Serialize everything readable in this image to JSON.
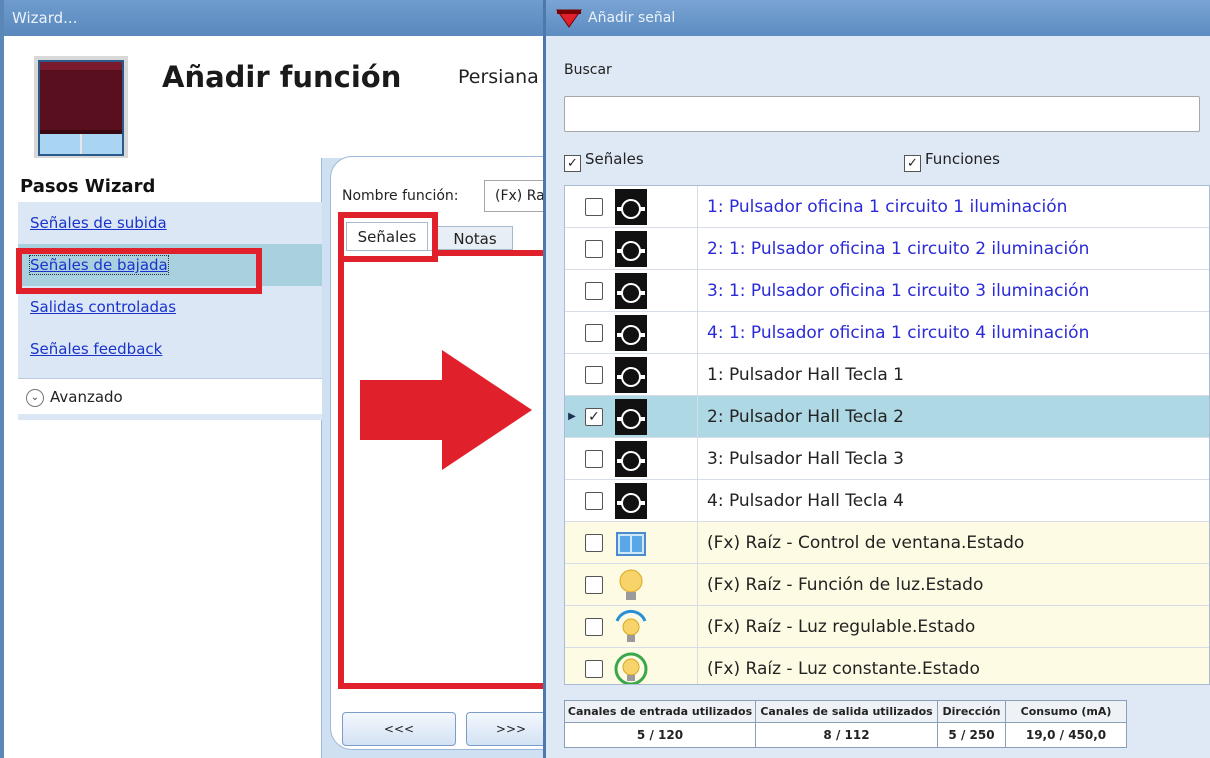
{
  "wizard": {
    "window_title": "Wizard...",
    "title": "Añadir función",
    "subtitle": "Persiana",
    "steps_title": "Pasos Wizard",
    "steps": [
      {
        "label": "Señales de subida"
      },
      {
        "label": "Señales de bajada"
      },
      {
        "label": "Salidas controladas"
      },
      {
        "label": "Señales feedback"
      }
    ],
    "active_step": "Señales de bajada",
    "advanced_label": "Avanzado",
    "function_name_label": "Nombre función:",
    "function_name_value": "(Fx) Raíz",
    "tabs": [
      {
        "label": "Señales"
      },
      {
        "label": "Notas"
      }
    ],
    "prev_button": "<<<",
    "next_button": ">>>"
  },
  "signal_window": {
    "title": "Añadir señal",
    "search_label": "Buscar",
    "search_value": "",
    "filters": [
      {
        "label": "Señales",
        "checked": true
      },
      {
        "label": "Funciones",
        "checked": true
      }
    ],
    "rows": [
      {
        "text": "1: Pulsador oficina 1 circuito 1 iluminación",
        "icon": "pushbutton-icon",
        "checked": false,
        "style": "blue"
      },
      {
        "text": "2: 1: Pulsador oficina 1 circuito 2 iluminación",
        "icon": "pushbutton-icon",
        "checked": false,
        "style": "blue"
      },
      {
        "text": "3: 1: Pulsador oficina 1 circuito 3 iluminación",
        "icon": "pushbutton-icon",
        "checked": false,
        "style": "blue"
      },
      {
        "text": "4: 1: Pulsador oficina 1 circuito 4 iluminación",
        "icon": "pushbutton-icon",
        "checked": false,
        "style": "blue"
      },
      {
        "text": "1: Pulsador Hall Tecla 1",
        "icon": "pushbutton-icon",
        "checked": false,
        "style": "normal"
      },
      {
        "text": "2: Pulsador Hall Tecla 2",
        "icon": "pushbutton-icon",
        "checked": true,
        "style": "selected"
      },
      {
        "text": "3: Pulsador Hall Tecla 3",
        "icon": "pushbutton-icon",
        "checked": false,
        "style": "normal"
      },
      {
        "text": "4: Pulsador Hall Tecla 4",
        "icon": "pushbutton-icon",
        "checked": false,
        "style": "normal"
      },
      {
        "text": "(Fx) Raíz - Control de ventana.Estado",
        "icon": "window-icon",
        "checked": false,
        "style": "fx"
      },
      {
        "text": "(Fx) Raíz - Función de luz.Estado",
        "icon": "bulb-icon",
        "checked": false,
        "style": "fx"
      },
      {
        "text": "(Fx) Raíz - Luz regulable.Estado",
        "icon": "dimmable-bulb-icon",
        "checked": false,
        "style": "fx"
      },
      {
        "text": "(Fx) Raíz - Luz constante.Estado",
        "icon": "constant-light-icon",
        "checked": false,
        "style": "fx"
      }
    ],
    "stats": [
      {
        "header": "Canales de entrada utilizados",
        "value": "5 / 120"
      },
      {
        "header": "Canales de salida utilizados",
        "value": "8 / 112"
      },
      {
        "header": "Dirección",
        "value": "5 / 250"
      },
      {
        "header": "Consumo (mA)",
        "value": "19,0 / 450,0"
      }
    ]
  },
  "colors": {
    "highlight_red": "#e0202a",
    "selected_row": "#aed8e4",
    "function_row": "#fdfbe4",
    "link_blue": "#1a33cc"
  }
}
